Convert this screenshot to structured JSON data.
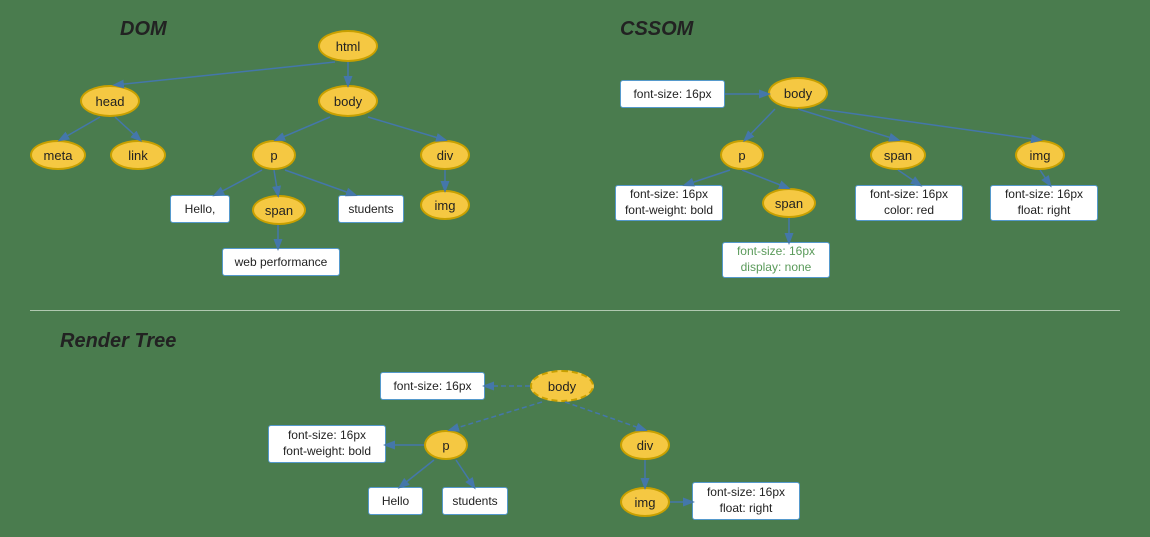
{
  "sections": {
    "dom_title": "DOM",
    "cssom_title": "CSSOM",
    "render_title": "Render Tree"
  },
  "dom_nodes": {
    "html": "html",
    "head": "head",
    "body": "body",
    "meta": "meta",
    "link": "link",
    "p": "p",
    "div": "div",
    "span": "span",
    "img_dom": "img",
    "hello": "Hello,",
    "students": "students",
    "web_performance": "web performance"
  },
  "cssom_nodes": {
    "body": "body",
    "p": "p",
    "span_cssom": "span",
    "img_cssom": "img",
    "span2": "span",
    "font16_body": "font-size: 16px",
    "font16_p": "font-size: 16px\nfont-weight: bold",
    "font16_span": "font-size: 16px\ncolor: red",
    "font16_img": "font-size: 16px\nfloat: right",
    "font16_span2": "font-size: 16px\ndisplay: none"
  },
  "render_nodes": {
    "body": "body",
    "p": "p",
    "div": "div",
    "img": "img",
    "hello": "Hello",
    "students": "students",
    "font16_body": "font-size: 16px",
    "font16_p": "font-size: 16px\nfont-weight: bold",
    "font16_img": "font-size: 16px\nfloat: right"
  }
}
